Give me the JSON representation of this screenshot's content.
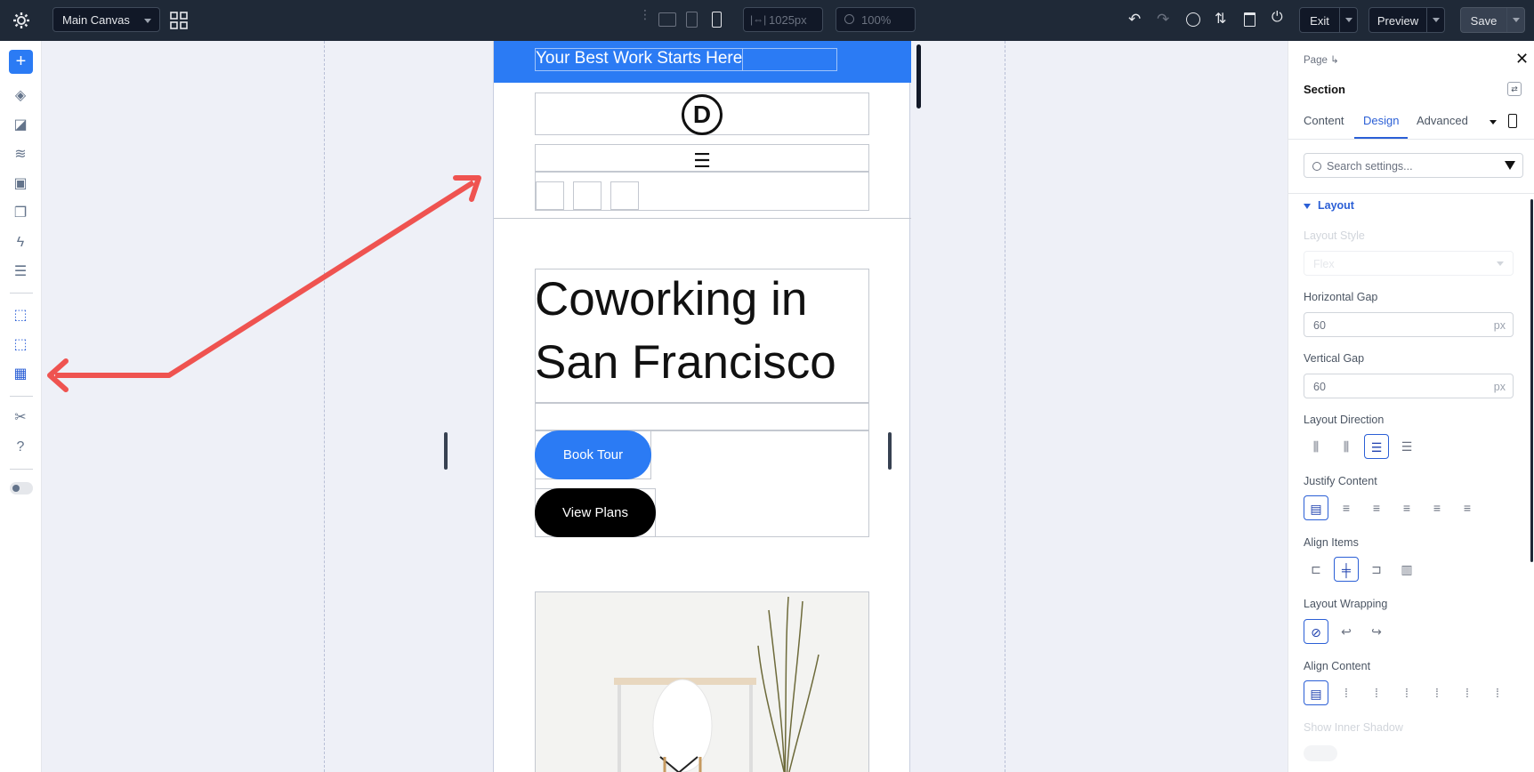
{
  "topbar": {
    "canvas_select": "Main Canvas",
    "width_value": "1025px",
    "zoom_value": "100%",
    "exit_label": "Exit",
    "preview_label": "Preview",
    "save_label": "Save"
  },
  "canvas": {
    "header_text": "Your Best Work Starts Here",
    "logo_letter": "D",
    "hero_title": "Coworking in San Francisco",
    "btn_primary": "Book Tour",
    "btn_secondary": "View Plans"
  },
  "panel": {
    "breadcrumb": "Page",
    "element_title": "Section",
    "tabs": [
      "Content",
      "Design",
      "Advanced"
    ],
    "active_tab": "Design",
    "search_placeholder": "Search settings...",
    "group_label": "Layout",
    "fields": {
      "layout_style_label": "Layout Style",
      "layout_style_value": "Flex",
      "h_gap_label": "Horizontal Gap",
      "h_gap_value": "60",
      "h_gap_unit": "px",
      "v_gap_label": "Vertical Gap",
      "v_gap_value": "60",
      "v_gap_unit": "px",
      "direction_label": "Layout Direction",
      "justify_label": "Justify Content",
      "align_items_label": "Align Items",
      "wrap_label": "Layout Wrapping",
      "align_content_label": "Align Content",
      "shadow_label": "Show Inner Shadow"
    }
  },
  "colors": {
    "accent": "#2b7bf4",
    "annotation_arrow": "#ef5350",
    "topbar_bg": "#1f2937",
    "button_black": "#000000"
  }
}
